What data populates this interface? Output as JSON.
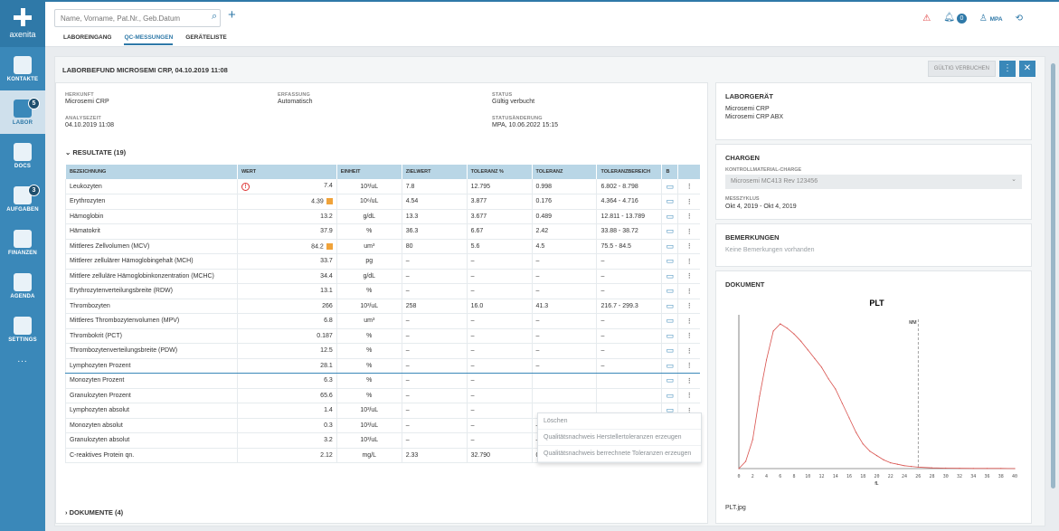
{
  "app": {
    "name": "axenita"
  },
  "sidebar": {
    "items": [
      {
        "label": "KONTAKTE"
      },
      {
        "label": "LABOR",
        "badge": "5"
      },
      {
        "label": "DOCS"
      },
      {
        "label": "AUFGABEN",
        "badge": "3"
      },
      {
        "label": "FINANZEN"
      },
      {
        "label": "AGENDA"
      },
      {
        "label": "SETTINGS"
      }
    ],
    "more": "..."
  },
  "topbar": {
    "search_placeholder": "Name, Vorname, Pat.Nr., Geb.Datum",
    "tabs": [
      "LABOREINGANG",
      "QC-MESSUNGEN",
      "GERÄTELISTE"
    ],
    "notifications": "0",
    "user": "MPA"
  },
  "header": {
    "title": "LABORBEFUND MICROSEMI CRP, 04.10.2019 11:08",
    "valid_button": "GÜLTIG VERBUCHEN"
  },
  "info": {
    "herkunft_label": "HERKUNFT",
    "herkunft": "Microsemi CRP",
    "erfassung_label": "ERFASSUNG",
    "erfassung": "Automatisch",
    "status_label": "STATUS",
    "status": "Gültig verbucht",
    "analysezeit_label": "ANALYSEZEIT",
    "analysezeit": "04.10.2019 11:08",
    "statusaenderung_label": "STATUSÄNDERUNG",
    "statusaenderung": "MPA, 10.06.2022 15:15"
  },
  "results": {
    "title": "RESULTATE (19)",
    "headers": [
      "BEZEICHNUNG",
      "WERT",
      "EINHEIT",
      "ZIELWERT",
      "TOLERANZ %",
      "TOLERANZ",
      "TOLERANZBEREICH",
      "B"
    ],
    "rows": [
      [
        "Leukozyten",
        "7.4",
        "10³/uL",
        "7.8",
        "12.795",
        "0.998",
        "6.802 - 8.798"
      ],
      [
        "Erythrozyten",
        "4.39",
        "10⁶/uL",
        "4.54",
        "3.877",
        "0.176",
        "4.364 - 4.716"
      ],
      [
        "Hämoglobin",
        "13.2",
        "g/dL",
        "13.3",
        "3.677",
        "0.489",
        "12.811 - 13.789"
      ],
      [
        "Hämatokrit",
        "37.9",
        "%",
        "36.3",
        "6.67",
        "2.42",
        "33.88 - 38.72"
      ],
      [
        "Mittleres Zellvolumen (MCV)",
        "84.2",
        "um³",
        "80",
        "5.6",
        "4.5",
        "75.5 - 84.5"
      ],
      [
        "Mittlerer zellulärer Hämoglobingehalt (MCH)",
        "33.7",
        "pg",
        "–",
        "–",
        "–",
        "–"
      ],
      [
        "Mittlere zelluläre Hämoglobinkonzentration (MCHC)",
        "34.4",
        "g/dL",
        "–",
        "–",
        "–",
        "–"
      ],
      [
        "Erythrozytenverteilungsbreite (RDW)",
        "13.1",
        "%",
        "–",
        "–",
        "–",
        "–"
      ],
      [
        "Thrombozyten",
        "266",
        "10³/uL",
        "258",
        "16.0",
        "41.3",
        "216.7 - 299.3"
      ],
      [
        "Mittleres Thrombozytenvolumen (MPV)",
        "6.8",
        "um³",
        "–",
        "–",
        "–",
        "–"
      ],
      [
        "Thrombokrit (PCT)",
        "0.187",
        "%",
        "–",
        "–",
        "–",
        "–"
      ],
      [
        "Thrombozytenverteilungsbreite (PDW)",
        "12.5",
        "%",
        "–",
        "–",
        "–",
        "–"
      ],
      [
        "Lymphozyten Prozent",
        "28.1",
        "%",
        "–",
        "–",
        "–",
        "–"
      ],
      [
        "Monozyten Prozent",
        "6.3",
        "%",
        "–",
        "–",
        "",
        ""
      ],
      [
        "Granulozyten Prozent",
        "65.6",
        "%",
        "–",
        "–",
        "",
        ""
      ],
      [
        "Lymphozyten absolut",
        "1.4",
        "10³/uL",
        "–",
        "–",
        "",
        ""
      ],
      [
        "Monozyten absolut",
        "0.3",
        "10³/uL",
        "–",
        "–",
        "–",
        "–"
      ],
      [
        "Granulozyten absolut",
        "3.2",
        "10³/uL",
        "–",
        "–",
        "–",
        "–"
      ],
      [
        "C-reaktives Protein qn.",
        "2.12",
        "mg/L",
        "2.33",
        "32.790",
        "0.764",
        "1.566 - 3.094"
      ]
    ]
  },
  "context_menu": [
    "Löschen",
    "Qualitätsnachweis Herstellertoleranzen erzeugen",
    "Qualitätsnachweis berrechnete Toleranzen erzeugen"
  ],
  "documents": {
    "title": "DOKUMENTE (4)"
  },
  "laborgeraet": {
    "title": "LABORGERÄT",
    "line1": "Microsemi CRP",
    "line2": "Microsemi CRP ABX"
  },
  "chargen": {
    "title": "CHARGEN",
    "charge_label": "KONTROLLMATERIAL-CHARGE",
    "charge_value": "Microsemi MC413 Rev 123456",
    "messzyklus_label": "MESSZYKLUS",
    "messzyklus": "Okt 4, 2019 - Okt 4, 2019"
  },
  "bemerkungen": {
    "title": "BEMERKUNGEN",
    "text": "Keine Bemerkungen vorhanden"
  },
  "dokument": {
    "title": "DOKUMENT",
    "filename": "PLT.jpg"
  },
  "chart_data": {
    "type": "line",
    "title": "PLT",
    "xlabel": "fL",
    "x_ticks": [
      0,
      2,
      4,
      6,
      8,
      10,
      12,
      14,
      16,
      18,
      20,
      22,
      24,
      26,
      28,
      30,
      32,
      34,
      36,
      38,
      40
    ],
    "xlim": [
      0,
      40
    ],
    "marker_label": "MM",
    "marker_x": 26,
    "x": [
      0,
      1,
      2,
      3,
      4,
      5,
      6,
      7,
      8,
      9,
      10,
      11,
      12,
      13,
      14,
      15,
      16,
      17,
      18,
      19,
      20,
      21,
      22,
      23,
      24,
      25,
      26,
      28,
      30,
      32,
      34,
      36,
      38,
      40
    ],
    "y": [
      0,
      0.05,
      0.2,
      0.5,
      0.75,
      0.95,
      1.0,
      0.97,
      0.93,
      0.88,
      0.82,
      0.76,
      0.7,
      0.62,
      0.55,
      0.45,
      0.35,
      0.25,
      0.17,
      0.12,
      0.09,
      0.06,
      0.04,
      0.03,
      0.02,
      0.015,
      0.01,
      0.005,
      0.003,
      0.002,
      0.001,
      0.001,
      0.001,
      0
    ],
    "color": "#d9534f"
  }
}
